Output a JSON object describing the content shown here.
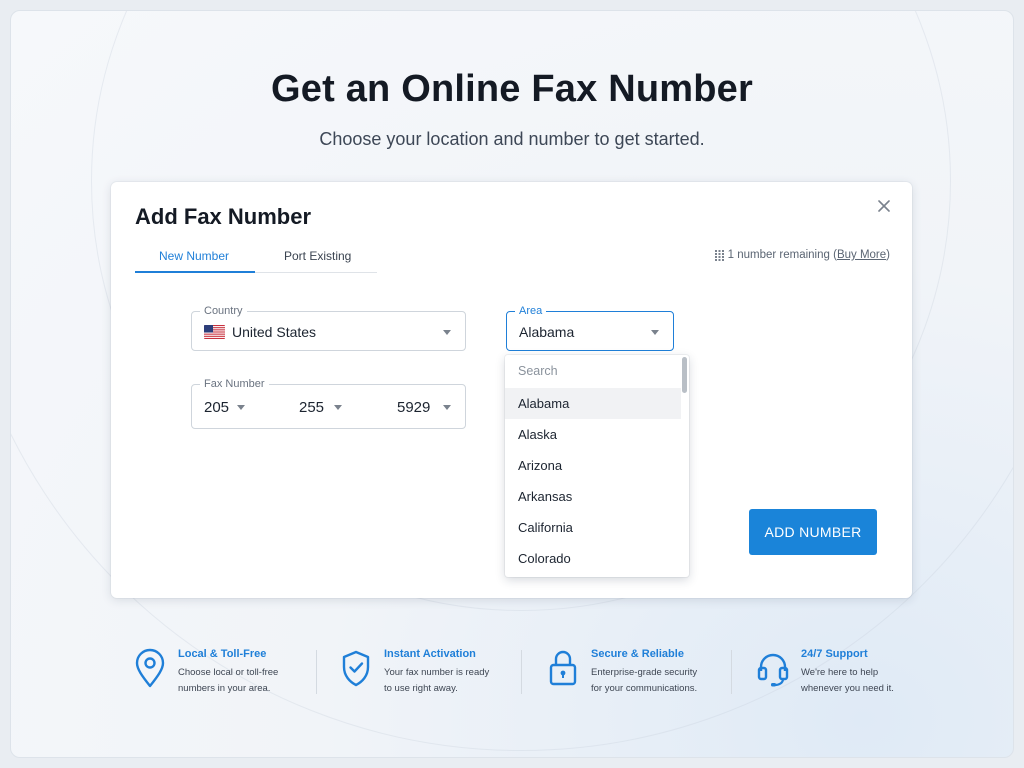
{
  "page": {
    "title": "Get an Online Fax Number",
    "subtitle": "Choose your location and number to get started."
  },
  "modal": {
    "title": "Add Fax Number",
    "close_icon": "close-icon",
    "tabs": [
      {
        "label": "New Number",
        "active": true
      },
      {
        "label": "Port Existing",
        "active": false
      }
    ],
    "remaining_text": "1 number remaining (",
    "buy_more": "Buy More",
    "remaining_close": ")",
    "country": {
      "label": "Country",
      "value": "United States",
      "flag": "us-flag-icon"
    },
    "area": {
      "label": "Area",
      "value": "Alabama",
      "search_placeholder": "Search",
      "options": [
        "Alabama",
        "Alaska",
        "Arizona",
        "Arkansas",
        "California",
        "Colorado"
      ],
      "highlighted": "Alabama"
    },
    "fax_number": {
      "label": "Fax Number",
      "parts": [
        "205",
        "255",
        "5929"
      ]
    },
    "add_button": "ADD NUMBER"
  },
  "features": [
    {
      "icon": "location-pin-icon",
      "title": "Local & Toll-Free",
      "desc_line1": "Choose local or toll-free",
      "desc_line2": "numbers in your area."
    },
    {
      "icon": "shield-check-icon",
      "title": "Instant Activation",
      "desc_line1": "Your fax number is ready",
      "desc_line2": "to use right away."
    },
    {
      "icon": "lock-icon",
      "title": "Secure & Reliable",
      "desc_line1": "Enterprise-grade security",
      "desc_line2": "for your communications."
    },
    {
      "icon": "headset-icon",
      "title": "24/7 Support",
      "desc_line1": "We're here to help",
      "desc_line2": "whenever you need it."
    }
  ],
  "colors": {
    "accent": "#1f7fd8",
    "button": "#1a84d9",
    "title": "#141a24"
  }
}
